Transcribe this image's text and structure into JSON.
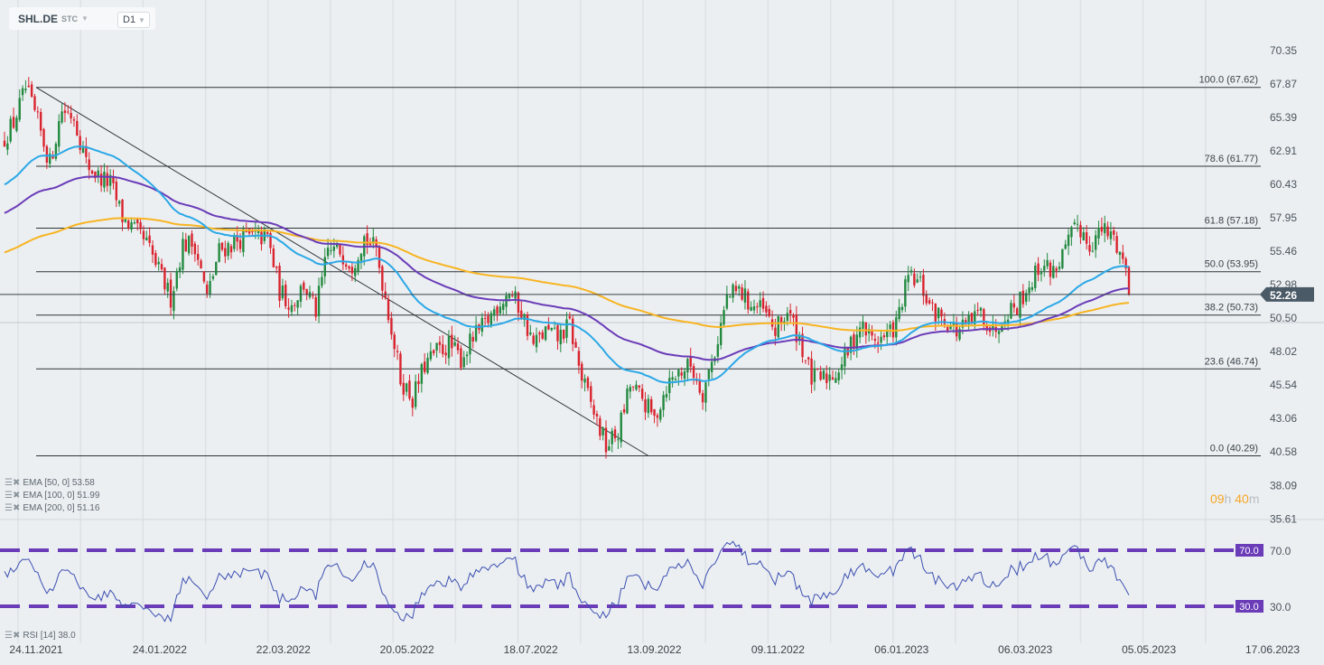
{
  "header": {
    "symbol": "SHL.DE",
    "type": "STC",
    "timeframe": "D1"
  },
  "countdown": {
    "hours": "09",
    "h": "h",
    "minutes": "40",
    "m": "m"
  },
  "legends": {
    "ema50": "EMA [50, 0] 53.58",
    "ema100": "EMA [100, 0] 51.99",
    "ema200": "EMA [200, 0] 51.16",
    "rsi": "RSI [14] 38.0"
  },
  "colors": {
    "up": "#22893f",
    "down": "#d9232e",
    "ema50": "#2aa8e6",
    "ema100": "#6a3cb8",
    "ema200": "#f7b421",
    "rsi": "#3b4fb0",
    "rsi_band": "#6a3cb8",
    "price_tag": "#4a5a66"
  },
  "chart_data": {
    "type": "candlestick",
    "title": "SHL.DE D1",
    "current_price": "52.26",
    "closes": [
      63.5,
      65,
      67.5,
      65,
      62,
      66,
      65.5,
      62,
      61,
      60.5,
      58,
      57,
      56,
      54,
      52,
      56,
      56,
      52,
      55.5,
      56,
      56.5,
      56.5,
      56.5,
      52.5,
      51.5,
      53,
      51,
      55.5,
      55.5,
      54.5,
      56.5,
      55.5,
      51,
      46,
      44.5,
      47,
      48,
      48.5,
      47.5,
      49,
      50,
      51.5,
      52.5,
      51,
      48.5,
      49.5,
      49,
      50,
      46,
      43.5,
      41,
      42,
      45.5,
      44.5,
      43,
      45.5,
      46.5,
      47,
      45,
      48,
      52,
      52.5,
      51.5,
      51,
      49.5,
      51,
      49,
      46,
      46,
      46.5,
      48,
      50,
      49,
      49,
      50,
      53.5,
      53,
      51,
      50.5,
      49.5,
      50,
      51,
      49.5,
      51,
      51.5,
      53,
      54.5,
      54,
      55.5,
      57.5,
      56,
      57,
      56.5,
      54.3
    ],
    "last_close": 52.26,
    "ema_seed": {
      "ema50": 60.3,
      "ema100": 58.2,
      "ema200": 55.3
    },
    "ylim": [
      34.9,
      71.5
    ],
    "y_ticks": [
      "70.35",
      "67.87",
      "65.39",
      "62.91",
      "60.43",
      "57.95",
      "55.46",
      "52.98",
      "50.50",
      "48.02",
      "45.54",
      "43.06",
      "40.58",
      "38.09",
      "35.61"
    ],
    "x_ticks": [
      "24.11.2021",
      "24.01.2022",
      "22.03.2022",
      "20.05.2022",
      "18.07.2022",
      "13.09.2022",
      "09.11.2022",
      "06.01.2023",
      "06.03.2023",
      "05.05.2023",
      "17.06.2023"
    ],
    "fibonacci": [
      {
        "level": 100.0,
        "price": 67.62,
        "label": "100.0 (67.62)"
      },
      {
        "level": 78.6,
        "price": 61.77,
        "label": "78.6 (61.77)"
      },
      {
        "level": 61.8,
        "price": 57.18,
        "label": "61.8 (57.18)"
      },
      {
        "level": 50.0,
        "price": 53.95,
        "label": "50.0 (53.95)"
      },
      {
        "level": 38.2,
        "price": 50.73,
        "label": "38.2 (50.73)"
      },
      {
        "level": 23.6,
        "price": 46.74,
        "label": "23.6 (46.74)"
      },
      {
        "level": 0.0,
        "price": 40.29,
        "label": "0.0 (40.29)"
      }
    ],
    "trendline": {
      "from_price": 67.62,
      "to_price": 40.29
    },
    "rsi": {
      "period": 14,
      "upper": 70.0,
      "lower": 30.0,
      "upper_label": "70.0",
      "lower_label": "30.0",
      "last": 38.0
    }
  }
}
